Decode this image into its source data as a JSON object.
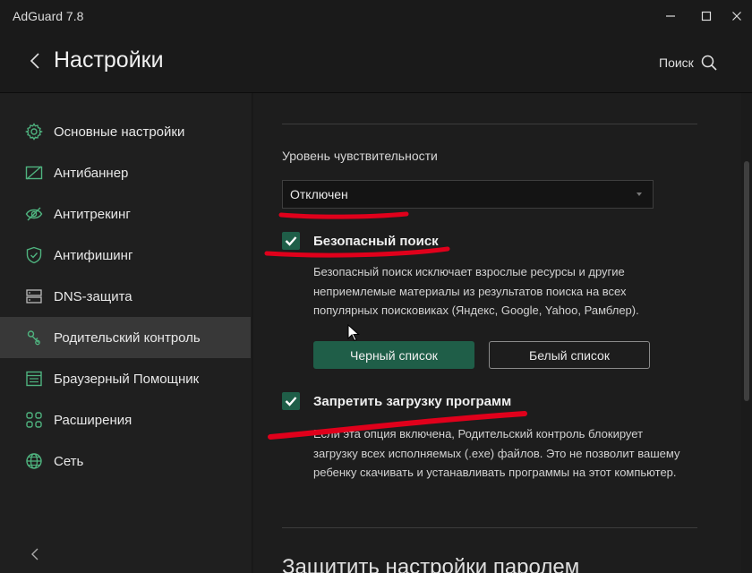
{
  "window": {
    "title": "AdGuard 7.8"
  },
  "header": {
    "title": "Настройки",
    "search_label": "Поиск"
  },
  "sidebar": {
    "items": [
      {
        "label": "Основные настройки",
        "icon": "gear-icon"
      },
      {
        "label": "Антибаннер",
        "icon": "antibanner-icon"
      },
      {
        "label": "Антитрекинг",
        "icon": "eye-off-icon"
      },
      {
        "label": "Антифишинг",
        "icon": "shield-check-icon"
      },
      {
        "label": "DNS-защита",
        "icon": "server-icon"
      },
      {
        "label": "Родительский контроль",
        "icon": "parental-control-icon",
        "active": true
      },
      {
        "label": "Браузерный Помощник",
        "icon": "browser-icon"
      },
      {
        "label": "Расширения",
        "icon": "extensions-grid-icon"
      },
      {
        "label": "Сеть",
        "icon": "globe-icon"
      }
    ]
  },
  "content": {
    "sensitivity": {
      "label": "Уровень чувствительности",
      "value": "Отключен"
    },
    "safe_search": {
      "checked": true,
      "title": "Безопасный поиск",
      "description": "Безопасный поиск исключает взрослые ресурсы и другие неприемлемые материалы из результатов поиска на всех популярных поисковиках (Яндекс, Google, Yahoo, Рамблер)."
    },
    "buttons": {
      "blacklist": "Черный список",
      "whitelist": "Белый список"
    },
    "block_downloads": {
      "checked": true,
      "title": "Запретить загрузку программ",
      "description": "Если эта опция включена, Родительский контроль блокирует загрузку всех исполняемых (.exe) файлов. Это не позволит вашему ребенку скачивать и устанавливать программы на этот компьютер."
    },
    "protect_section_title": "Защитить настройки паролем"
  },
  "colors": {
    "accent": "#1f5e48",
    "annotation": "#e0001b",
    "background": "#1d1d1d"
  }
}
